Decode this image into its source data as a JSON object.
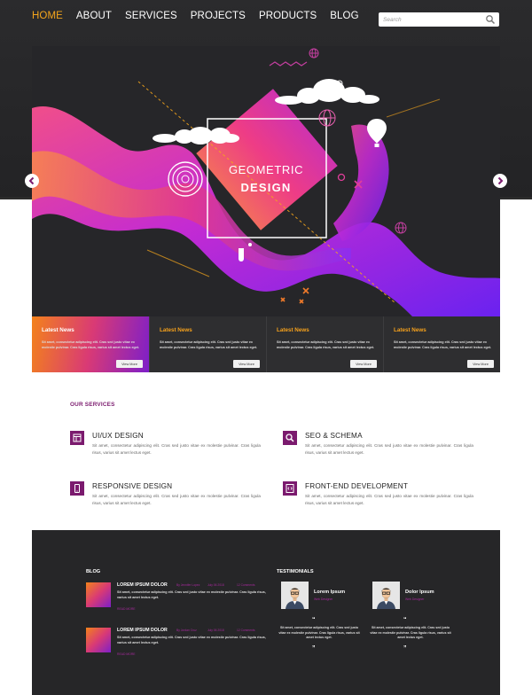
{
  "nav": {
    "items": [
      {
        "label": "HOME",
        "active": true
      },
      {
        "label": "ABOUT",
        "active": false
      },
      {
        "label": "SERVICES",
        "active": false
      },
      {
        "label": "PROJECTS",
        "active": false
      },
      {
        "label": "PRODUCTS",
        "active": false
      },
      {
        "label": "BLOG",
        "active": false
      }
    ],
    "search_placeholder": "Search"
  },
  "hero": {
    "title_line1": "GEOMETRIC",
    "title_line2": "DESIGN"
  },
  "news": [
    {
      "title": "Latest News",
      "text": "Sit amet, consectetur adipiscing elit. Cras sed justo vitae ex molestie pulvinar. Cras ligula risus, varius sit amet lectus eget.",
      "button": "View More"
    },
    {
      "title": "Latest News",
      "text": "Sit amet, consectetur adipiscing elit. Cras sed justo vitae ex molestie pulvinar. Cras ligula risus, varius sit amet lectus eget.",
      "button": "View More"
    },
    {
      "title": "Latest News",
      "text": "Sit amet, consectetur adipiscing elit. Cras sed justo vitae ex molestie pulvinar. Cras ligula risus, varius sit amet lectus eget.",
      "button": "View More"
    },
    {
      "title": "Latest News",
      "text": "Sit amet, consectetur adipiscing elit. Cras sed justo vitae ex molestie pulvinar. Cras ligula risus, varius sit amet lectus eget.",
      "button": "View More"
    }
  ],
  "services": {
    "heading": "OUR SERVICES",
    "items": [
      {
        "title": "UI/UX DESIGN",
        "icon": "layout-icon",
        "text": "Sit amet, consectetur adipiscing elit. Cras sed justo vitae ex molestie pulvinar. Cras ligula risus, varius sit amet lectus eget."
      },
      {
        "title": "SEO & SCHEMA",
        "icon": "magnifier-icon",
        "text": "Sit amet, consectetur adipiscing elit. Cras sed justo vitae ex molestie pulvinar. Cras ligula risus, varius sit amet lectus eget."
      },
      {
        "title": "RESPONSIVE DESIGN",
        "icon": "mobile-icon",
        "text": "Sit amet, consectetur adipiscing elit. Cras sed justo vitae ex molestie pulvinar. Cras ligula risus, varius sit amet lectus eget."
      },
      {
        "title": "FRONT-END DEVELOPMENT",
        "icon": "code-icon",
        "text": "Sit amet, consectetur adipiscing elit. Cras sed justo vitae ex molestie pulvinar. Cras ligula risus, varius sit amet lectus eget."
      }
    ]
  },
  "blog": {
    "heading": "BLOG",
    "posts": [
      {
        "title": "LOREM IPSUM DOLOR",
        "author": "By Jennifer Lopez",
        "date": "July 06 2018",
        "comments": "12 Comments",
        "text": "Sit amet, consectetur adipiscing elit. Cras sed justo vitae ex molestie pulvinar. Cras ligula risus, varius sit amet lectus eget.",
        "link": "READ MORE"
      },
      {
        "title": "LOREM IPSUM DOLOR",
        "author": "By Jordan Cruz",
        "date": "July 06 2018",
        "comments": "12 Comments",
        "text": "Sit amet, consectetur adipiscing elit. Cras sed justo vitae ex molestie pulvinar. Cras ligula risus, varius sit amet lectus eget.",
        "link": "READ MORE"
      }
    ]
  },
  "testimonials": {
    "heading": "TESTIMONIALS",
    "items": [
      {
        "name": "Lorem Ipsum",
        "role": "Web Designer",
        "text": "Sit amet, consectetur adipiscing elit. Cras sed justo vitae ex molestie pulvinar. Cras ligula risus, varius sit amet lectus eget.",
        "quote_open": "“",
        "quote_close": "”"
      },
      {
        "name": "Dolor Ipsum",
        "role": "Web Designer",
        "text": "Sit amet, consectetur adipiscing elit. Cras sed justo vitae ex molestie pulvinar. Cras ligula risus, varius sit amet lectus eget.",
        "quote_open": "“",
        "quote_close": "”"
      }
    ]
  },
  "colors": {
    "accent_orange": "#f4a51c",
    "brand_purple": "#7b1a6e",
    "gradient_magenta": "#d93a75",
    "gradient_violet": "#7d1fc9",
    "dark_bg": "#262628"
  }
}
